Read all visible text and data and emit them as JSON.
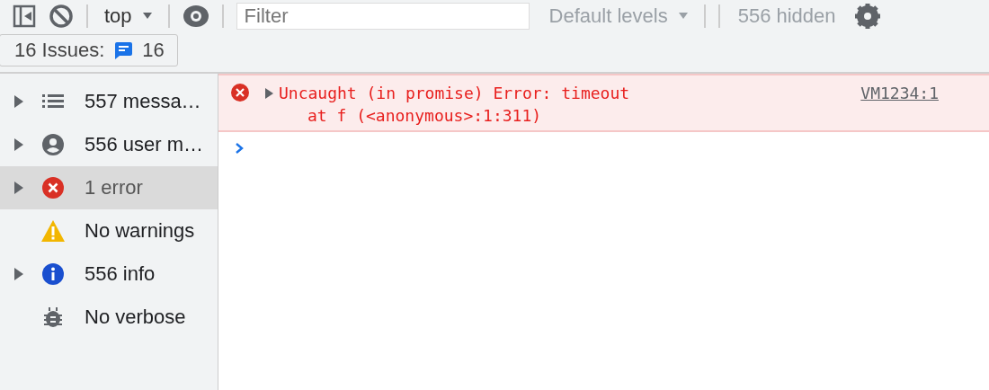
{
  "toolbar": {
    "context": "top",
    "filter": {
      "placeholder": "Filter"
    },
    "levels": "Default levels",
    "hidden_count": "556 hidden"
  },
  "issues": {
    "label": "16 Issues:",
    "count": "16"
  },
  "sidebar": {
    "items": [
      {
        "kind": "messages",
        "label": "557 messa…",
        "expandable": true,
        "selected": false
      },
      {
        "kind": "user",
        "label": "556 user m…",
        "expandable": true,
        "selected": false
      },
      {
        "kind": "error",
        "label": "1 error",
        "expandable": true,
        "selected": true
      },
      {
        "kind": "warning",
        "label": "No warnings",
        "expandable": false,
        "selected": false
      },
      {
        "kind": "info",
        "label": "556 info",
        "expandable": true,
        "selected": false
      },
      {
        "kind": "verbose",
        "label": "No verbose",
        "expandable": false,
        "selected": false
      }
    ]
  },
  "console": {
    "messages": [
      {
        "kind": "error",
        "expanded": false,
        "text": "Uncaught (in promise) Error: timeout",
        "stack": "at f (<anonymous>:1:311)",
        "source": "VM1234:1"
      }
    ]
  }
}
